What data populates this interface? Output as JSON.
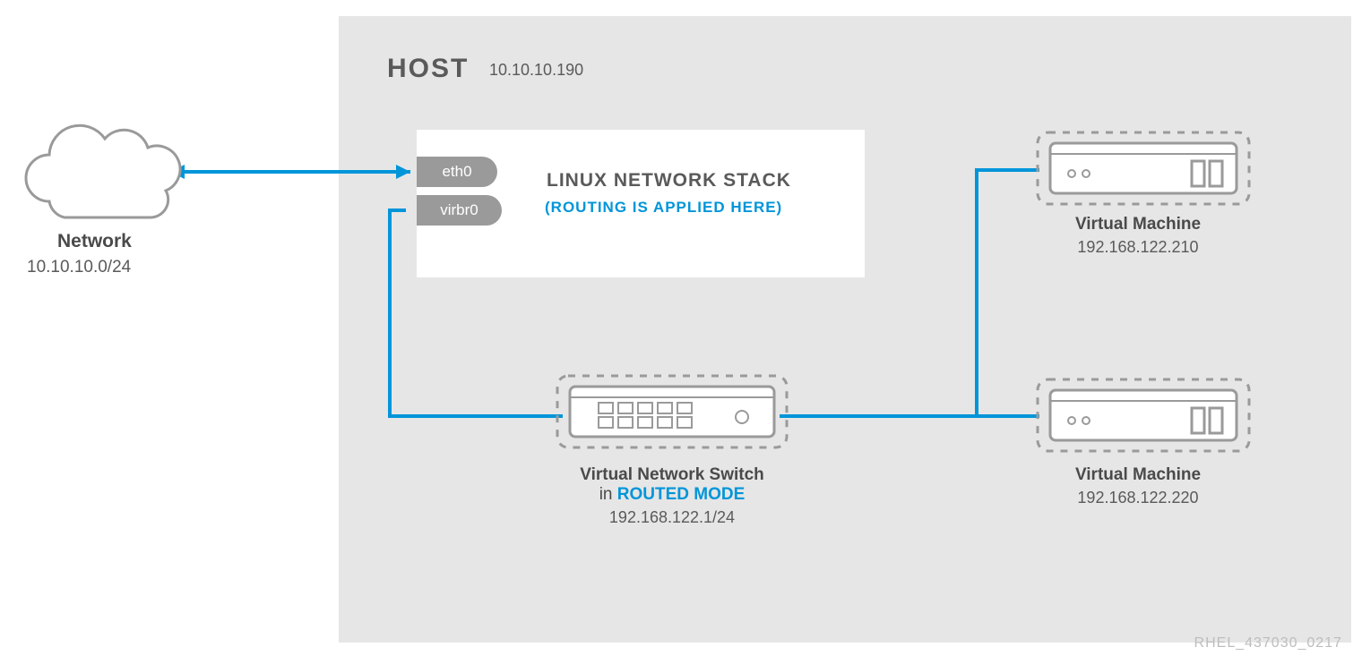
{
  "host": {
    "title": "HOST",
    "ip": "10.10.10.190"
  },
  "network": {
    "label": "Network",
    "subnet": "10.10.10.0/24"
  },
  "stack": {
    "title": "LINUX NETWORK STACK",
    "subtitle": "(ROUTING IS APPLIED HERE)",
    "interfaces": {
      "eth0": "eth0",
      "virbr0": "virbr0"
    }
  },
  "switch": {
    "label_line1": "Virtual Network Switch",
    "label_prefix": "in ",
    "label_mode": "ROUTED MODE",
    "ip": "192.168.122.1/24"
  },
  "vm1": {
    "label": "Virtual Machine",
    "ip": "192.168.122.210"
  },
  "vm2": {
    "label": "Virtual Machine",
    "ip": "192.168.122.220"
  },
  "footer_id": "RHEL_437030_0217",
  "colors": {
    "accent": "#0095d9",
    "gray": "#9a9a9a",
    "gray_dark": "#5a5a5a",
    "bg_host": "#e6e6e6"
  }
}
